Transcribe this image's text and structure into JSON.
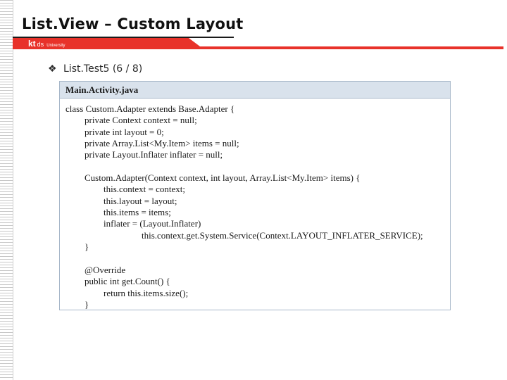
{
  "slide": {
    "title": "List.View – Custom Layout",
    "brand": {
      "kt": "kt",
      "ds": "ds",
      "university": "University"
    },
    "bullet": {
      "icon": "diamond-bullet-icon",
      "text": "List.Test5 (6 / 8)"
    }
  },
  "code_panel": {
    "filename": "Main.Activity.java",
    "lines": [
      {
        "indent": 0,
        "text": "class Custom.Adapter extends Base.Adapter {"
      },
      {
        "indent": 1,
        "text": "private Context context = null;"
      },
      {
        "indent": 1,
        "text": "private int layout = 0;"
      },
      {
        "indent": 1,
        "text": "private Array.List<My.Item> items = null;"
      },
      {
        "indent": 1,
        "text": "private Layout.Inflater inflater = null;"
      },
      {
        "indent": 0,
        "text": ""
      },
      {
        "indent": 1,
        "text": "Custom.Adapter(Context context, int layout, Array.List<My.Item> items) {"
      },
      {
        "indent": 2,
        "text": "this.context = context;"
      },
      {
        "indent": 2,
        "text": "this.layout = layout;"
      },
      {
        "indent": 2,
        "text": "this.items = items;"
      },
      {
        "indent": 2,
        "text": "inflater = (Layout.Inflater)"
      },
      {
        "indent": 4,
        "text": "this.context.get.System.Service(Context.LAYOUT_INFLATER_SERVICE);"
      },
      {
        "indent": 1,
        "text": "}"
      },
      {
        "indent": 0,
        "text": ""
      },
      {
        "indent": 1,
        "text": "@Override"
      },
      {
        "indent": 1,
        "text": "public int get.Count() {"
      },
      {
        "indent": 2,
        "text": "return this.items.size();"
      },
      {
        "indent": 1,
        "text": "}"
      }
    ]
  },
  "colors": {
    "brand_red": "#e8322a",
    "panel_header": "#d9e2ec",
    "panel_border": "#a7b7c9"
  }
}
